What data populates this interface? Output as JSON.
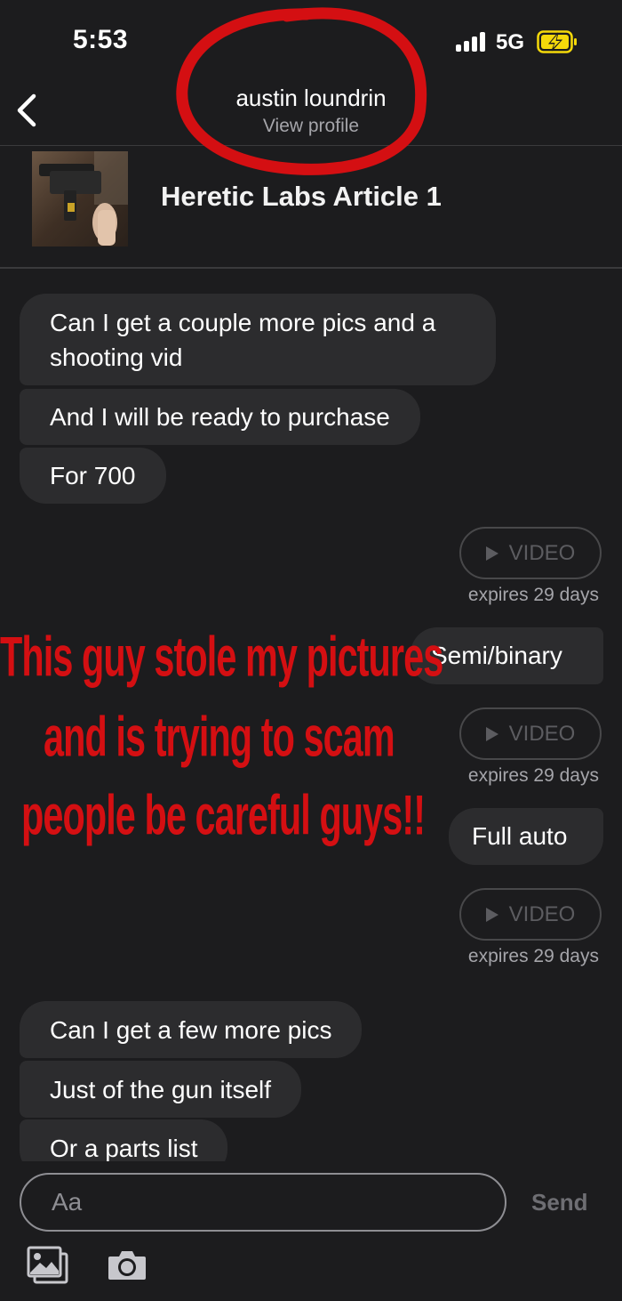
{
  "status_bar": {
    "time": "5:53",
    "network": "5G"
  },
  "header": {
    "contact_name": "austin loundrin",
    "subtitle": "View profile"
  },
  "listing": {
    "title": "Heretic Labs Article 1"
  },
  "messages": [
    {
      "direction": "incoming",
      "text": "Can I get a couple more pics and a shooting vid"
    },
    {
      "direction": "incoming",
      "text": "And I will be ready to purchase"
    },
    {
      "direction": "incoming",
      "text": "For 700"
    },
    {
      "direction": "outgoing",
      "type": "video",
      "label": "VIDEO",
      "expires": "expires 29 days"
    },
    {
      "direction": "outgoing",
      "text": "Semi/binary"
    },
    {
      "direction": "outgoing",
      "type": "video",
      "label": "VIDEO",
      "expires": "expires 29 days"
    },
    {
      "direction": "outgoing",
      "text": "Full auto"
    },
    {
      "direction": "outgoing",
      "type": "video",
      "label": "VIDEO",
      "expires": "expires 29 days"
    },
    {
      "direction": "incoming",
      "text": "Can I get a few more pics"
    },
    {
      "direction": "incoming",
      "text": "Just of the gun itself"
    },
    {
      "direction": "incoming",
      "text": "Or a parts list"
    }
  ],
  "annotation": {
    "lines": [
      "This guy stole my pictures",
      "and is trying to scam",
      "people be careful guys!!"
    ],
    "color": "#d40f12"
  },
  "composer": {
    "placeholder": "Aa",
    "send_label": "Send"
  },
  "colors": {
    "background": "#1c1c1e",
    "bubble": "#2c2c2e",
    "accent_red": "#d40f12",
    "battery": "#f5d90a"
  }
}
